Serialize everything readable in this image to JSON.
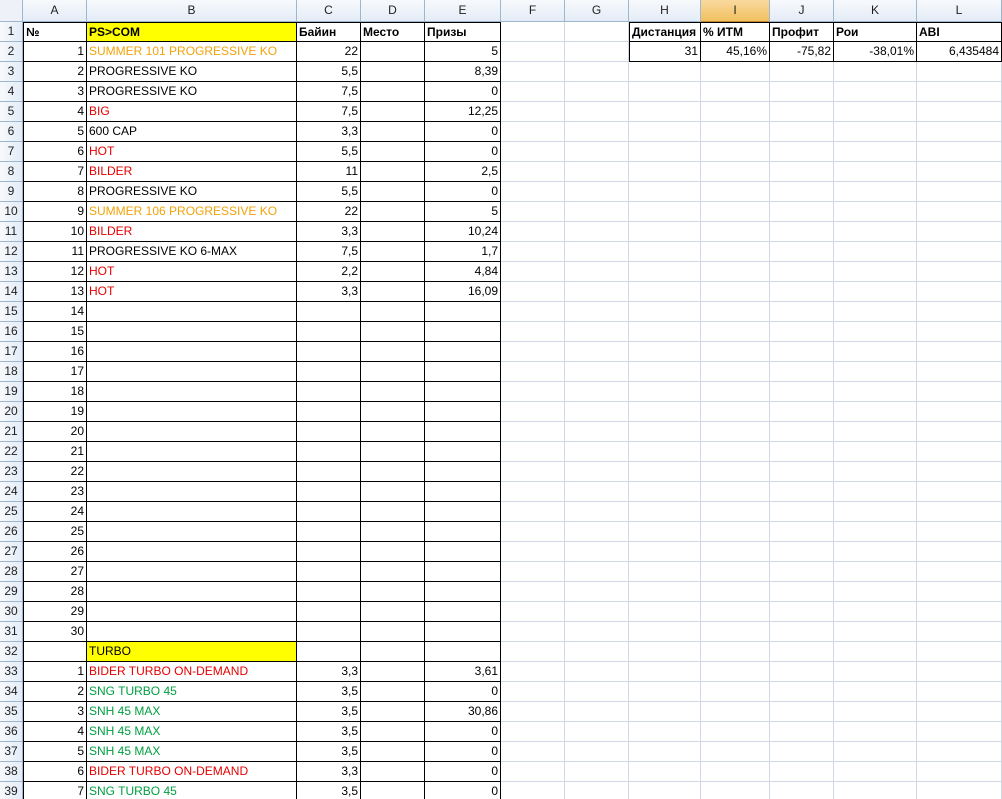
{
  "column_headers": [
    "A",
    "B",
    "C",
    "D",
    "E",
    "F",
    "G",
    "H",
    "I",
    "J",
    "K",
    "L"
  ],
  "selected_column": "I",
  "row_numbers": [
    "1",
    "2",
    "3",
    "4",
    "5",
    "6",
    "7",
    "8",
    "9",
    "10",
    "11",
    "12",
    "13",
    "14",
    "15",
    "16",
    "17",
    "18",
    "19",
    "20",
    "21",
    "22",
    "23",
    "24",
    "25",
    "26",
    "27",
    "28",
    "29",
    "30",
    "31",
    "32",
    "33",
    "34",
    "35",
    "36",
    "37",
    "38",
    "39"
  ],
  "header_row": {
    "num": "№",
    "name": "PS>COM",
    "buyin": "Байин",
    "place": "Место",
    "prizes": "Призы"
  },
  "tournaments": [
    {
      "num": "1",
      "name": "SUMMER 101 PROGRESSIVE KO",
      "color": "orange",
      "buyin": "22",
      "place": "",
      "prize": "5"
    },
    {
      "num": "2",
      "name": "PROGRESSIVE KO",
      "color": "black",
      "buyin": "5,5",
      "place": "",
      "prize": "8,39"
    },
    {
      "num": "3",
      "name": "PROGRESSIVE KO",
      "color": "black",
      "buyin": "7,5",
      "place": "",
      "prize": "0"
    },
    {
      "num": "4",
      "name": "BIG",
      "color": "red",
      "buyin": "7,5",
      "place": "",
      "prize": "12,25"
    },
    {
      "num": "5",
      "name": "600 CAP",
      "color": "black",
      "buyin": "3,3",
      "place": "",
      "prize": "0"
    },
    {
      "num": "6",
      "name": "HOT",
      "color": "red",
      "buyin": "5,5",
      "place": "",
      "prize": "0"
    },
    {
      "num": "7",
      "name": "BILDER",
      "color": "red",
      "buyin": "11",
      "place": "",
      "prize": "2,5"
    },
    {
      "num": "8",
      "name": "PROGRESSIVE KO",
      "color": "black",
      "buyin": "5,5",
      "place": "",
      "prize": "0"
    },
    {
      "num": "9",
      "name": "SUMMER 106 PROGRESSIVE KO",
      "color": "orange",
      "buyin": "22",
      "place": "",
      "prize": "5"
    },
    {
      "num": "10",
      "name": "BILDER",
      "color": "red",
      "buyin": "3,3",
      "place": "",
      "prize": "10,24"
    },
    {
      "num": "11",
      "name": "PROGRESSIVE KO 6-MAX",
      "color": "black",
      "buyin": "7,5",
      "place": "",
      "prize": "1,7"
    },
    {
      "num": "12",
      "name": "HOT",
      "color": "red",
      "buyin": "2,2",
      "place": "",
      "prize": "4,84"
    },
    {
      "num": "13",
      "name": "HOT",
      "color": "red",
      "buyin": "3,3",
      "place": "",
      "prize": "16,09"
    },
    {
      "num": "14",
      "name": "",
      "color": "black",
      "buyin": "",
      "place": "",
      "prize": ""
    },
    {
      "num": "15",
      "name": "",
      "color": "black",
      "buyin": "",
      "place": "",
      "prize": ""
    },
    {
      "num": "16",
      "name": "",
      "color": "black",
      "buyin": "",
      "place": "",
      "prize": ""
    },
    {
      "num": "17",
      "name": "",
      "color": "black",
      "buyin": "",
      "place": "",
      "prize": ""
    },
    {
      "num": "18",
      "name": "",
      "color": "black",
      "buyin": "",
      "place": "",
      "prize": ""
    },
    {
      "num": "19",
      "name": "",
      "color": "black",
      "buyin": "",
      "place": "",
      "prize": ""
    },
    {
      "num": "20",
      "name": "",
      "color": "black",
      "buyin": "",
      "place": "",
      "prize": ""
    },
    {
      "num": "21",
      "name": "",
      "color": "black",
      "buyin": "",
      "place": "",
      "prize": ""
    },
    {
      "num": "22",
      "name": "",
      "color": "black",
      "buyin": "",
      "place": "",
      "prize": ""
    },
    {
      "num": "23",
      "name": "",
      "color": "black",
      "buyin": "",
      "place": "",
      "prize": ""
    },
    {
      "num": "24",
      "name": "",
      "color": "black",
      "buyin": "",
      "place": "",
      "prize": ""
    },
    {
      "num": "25",
      "name": "",
      "color": "black",
      "buyin": "",
      "place": "",
      "prize": ""
    },
    {
      "num": "26",
      "name": "",
      "color": "black",
      "buyin": "",
      "place": "",
      "prize": ""
    },
    {
      "num": "27",
      "name": "",
      "color": "black",
      "buyin": "",
      "place": "",
      "prize": ""
    },
    {
      "num": "28",
      "name": "",
      "color": "black",
      "buyin": "",
      "place": "",
      "prize": ""
    },
    {
      "num": "29",
      "name": "",
      "color": "black",
      "buyin": "",
      "place": "",
      "prize": ""
    },
    {
      "num": "30",
      "name": "",
      "color": "black",
      "buyin": "",
      "place": "",
      "prize": ""
    }
  ],
  "turbo_label": "TURBO",
  "turbo": [
    {
      "num": "1",
      "name": "BIDER TURBO ON-DEMAND",
      "color": "red",
      "buyin": "3,3",
      "place": "",
      "prize": "3,61"
    },
    {
      "num": "2",
      "name": "SNG TURBO 45",
      "color": "green",
      "buyin": "3,5",
      "place": "",
      "prize": "0"
    },
    {
      "num": "3",
      "name": "SNH 45 MAX",
      "color": "green",
      "buyin": "3,5",
      "place": "",
      "prize": "30,86"
    },
    {
      "num": "4",
      "name": "SNH 45 MAX",
      "color": "green",
      "buyin": "3,5",
      "place": "",
      "prize": "0"
    },
    {
      "num": "5",
      "name": "SNH 45 MAX",
      "color": "green",
      "buyin": "3,5",
      "place": "",
      "prize": "0"
    },
    {
      "num": "6",
      "name": "BIDER TURBO ON-DEMAND",
      "color": "red",
      "buyin": "3,3",
      "place": "",
      "prize": "0"
    },
    {
      "num": "7",
      "name": "SNG TURBO 45",
      "color": "green",
      "buyin": "3,5",
      "place": "",
      "prize": "0"
    }
  ],
  "stats": {
    "headers": [
      "Дистанция",
      "% ИТМ",
      "Профит",
      "Рои",
      "ABI"
    ],
    "values": [
      "31",
      "45,16%",
      "-75,82",
      "-38,01%",
      "6,435484"
    ]
  },
  "colors": {
    "highlight": "#ffff00",
    "orange": "#f0a30a",
    "red": "#e60000",
    "green": "#00a040",
    "selected_header": "#f1c15f"
  }
}
